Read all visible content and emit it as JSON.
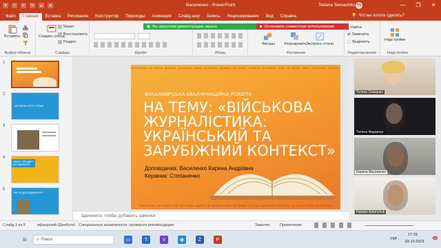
{
  "window": {
    "title": "Василенко - PowerPoint",
    "user": "Tetiana Semashko",
    "avatar_initials": "TS",
    "quick_access": [
      "save-icon",
      "undo-icon",
      "redo-icon",
      "present-icon",
      "customize-icon"
    ],
    "controls": [
      "—",
      "❐",
      "✕"
    ]
  },
  "ribbon_tabs": [
    "Файл",
    "Главная",
    "Вставка",
    "Рисование",
    "Конструктор",
    "Переходы",
    "Анимация",
    "Слайд-шоу",
    "Запись",
    "Рецензирование",
    "Вид",
    "Справка"
  ],
  "active_tab": "Главная",
  "tell_me": "Что вы хотите сделать?",
  "banners": {
    "presenting": "Вы запустили демонстрацию экрана",
    "stop_sharing": "Остановить совместное использование"
  },
  "ribbon": {
    "clipboard": {
      "label": "Буфер обмена",
      "paste": "Вставить"
    },
    "slides": {
      "label": "Слайды",
      "new_slide": "Создать слайд",
      "layout": "Макет",
      "reset": "Восстановить",
      "section": "Раздел"
    },
    "font": {
      "label": "Шрифт"
    },
    "paragraph": {
      "label": "Абзац"
    },
    "drawing": {
      "label": "Рисование",
      "shapes": "Фигуры",
      "arrange": "Упорядочить",
      "quick_styles": "Экспресс-стили"
    },
    "editing": {
      "label": "Редактирование",
      "find": "Найти",
      "replace": "Заменить",
      "select": "Выделить"
    },
    "addins": {
      "label": "Надстройки",
      "item": "Надстройки"
    }
  },
  "thumbnails": [
    {
      "num": "1",
      "title": "",
      "selected": true
    },
    {
      "num": "2",
      "title": "АКТУАЛЬНІСТЬ ТЕМИ",
      "selected": false
    },
    {
      "num": "3",
      "title": "",
      "selected": false
    },
    {
      "num": "4",
      "title": "ОБ'ЄКТ І ПРЕДМЕТ ДОСЛІДЖЕННЯ",
      "selected": false
    },
    {
      "num": "5",
      "title": "МЕТА ДОСЛІДЖЕННЯ",
      "selected": false
    }
  ],
  "slide": {
    "ticker_top": "#STOPRUSSIA · ЦЕ УКРАЇНА · ДОНЕЦЬК · ЦЕ УКРАЇНА · ХАРКІВ · ЦЕ УКРАЇНА · ДОНЕЦЬК · ЦЕ УКРАЇНА · ЛУГАНСЬК · ЦЕ УКРАЇНА · КРИМ · ЦЕ УКРАЇНА · ОДЕСА · ЦЕ УКРАЇНА · ЧЕРНІГІВ · ЦЕ УКРАЇНА · #STOPRUSSIA",
    "ticker_bottom": "#STOPRUSSIA · ЦЕ УКРАЇНА · КИЇВ · ЦЕ УКРАЇНА · ДНІПРО · ЦЕ УКРАЇНА · ХАРКІВ · ЦЕ УКРАЇНА · ДОНЕЦЬК · ЦЕ УКРАЇНА · ЛУГАНСЬК · ЦЕ УКРАЇНА · КРИМ · #STOPRUSSIA",
    "subtitle": "БАКАЛАВРСЬКА КВАЛІФІКАЦІЙНА РОБОТА",
    "title": "НА ТЕМУ: «ВІЙСЬКОВА ЖУРНАЛІСТИКА: УКРАЇНСЬКИЙ ТА ЗАРУБІЖНИЙ КОНТЕКСТ»",
    "author": "Доповідачка: Василенко Карина Андріївна",
    "supervisor": "Керівник: Степаненко"
  },
  "notes_placeholder": "Щелкните, чтобы добавить заметки",
  "participants": [
    {
      "name": "Тетяна Семашко"
    },
    {
      "name": "Тетяна Федорчук"
    },
    {
      "name": "Карина Василенко"
    },
    {
      "name": "Nataliia Adamchuk"
    }
  ],
  "statusbar": {
    "slide_counter": "Слайд 1 из 9",
    "theme": "ифаорский (Джибути)",
    "accessibility": "Специальные возможности: проверьте рекомендации",
    "notes": "Заметки",
    "comments": "Примечания"
  },
  "taskbar": {
    "search_placeholder": "Поиск",
    "language": "УКР",
    "time": "17:15",
    "date": "03.10.2023",
    "notification_count": "25"
  },
  "colors": {
    "accent": "#c43e1c",
    "share_green": "#2fa84f",
    "share_red": "#d13438"
  }
}
